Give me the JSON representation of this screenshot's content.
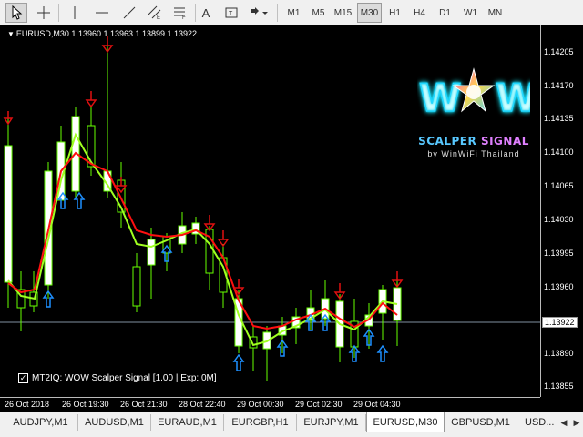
{
  "toolbar": {
    "tools": [
      {
        "icon": "cursor-icon"
      },
      {
        "icon": "crosshair-icon"
      },
      {
        "icon": "vertical-line-icon"
      },
      {
        "icon": "horizontal-line-icon"
      },
      {
        "icon": "trendline-icon"
      },
      {
        "icon": "equidistant-channel-icon"
      },
      {
        "icon": "fibonacci-icon"
      },
      {
        "icon": "text-icon",
        "glyph": "A"
      },
      {
        "icon": "text-label-icon"
      },
      {
        "icon": "arrows-dropdown-icon"
      }
    ],
    "timeframes": [
      "M1",
      "M5",
      "M15",
      "M30",
      "H1",
      "H4",
      "D1",
      "W1",
      "MN"
    ],
    "active_timeframe": "M30"
  },
  "chart": {
    "title": "EURUSD,M30  1.13960 1.13963 1.13899 1.13922",
    "indicator_label": "MT2IQ: WOW Scalper Signal [1.00 | Exp: 0M]",
    "price_labels": [
      "1.14205",
      "1.14170",
      "1.14135",
      "1.14100",
      "1.14065",
      "1.14030",
      "1.13995",
      "1.13960",
      "1.13922",
      "1.13890",
      "1.13855"
    ],
    "current_price": "1.13922",
    "time_labels": [
      "26 Oct 2018",
      "26 Oct 19:30",
      "26 Oct 21:30",
      "28 Oct 22:40",
      "29 Oct 00:30",
      "29 Oct 02:30",
      "29 Oct 04:30"
    ],
    "colors": {
      "background": "#000000",
      "bull_candle": "#ffffff",
      "bear_candle": "#000000",
      "candle_outline": "#66ff00",
      "fast_line": "#a0ff20",
      "slow_line": "#ff1010",
      "buy_arrow": "#1e90ff",
      "sell_arrow": "#e01010"
    },
    "logo": {
      "wordmark": "WOW",
      "brand_a": "SCALPER",
      "brand_b": "SIGNAL",
      "byline": "by WinWiFi Thailand"
    }
  },
  "tabs": {
    "items": [
      "AUDJPY,M1",
      "AUDUSD,M1",
      "EURAUD,M1",
      "EURGBP,H1",
      "EURJPY,M1",
      "EURUSD,M30",
      "GBPUSD,M1",
      "USD..."
    ],
    "active": "EURUSD,M30"
  }
}
